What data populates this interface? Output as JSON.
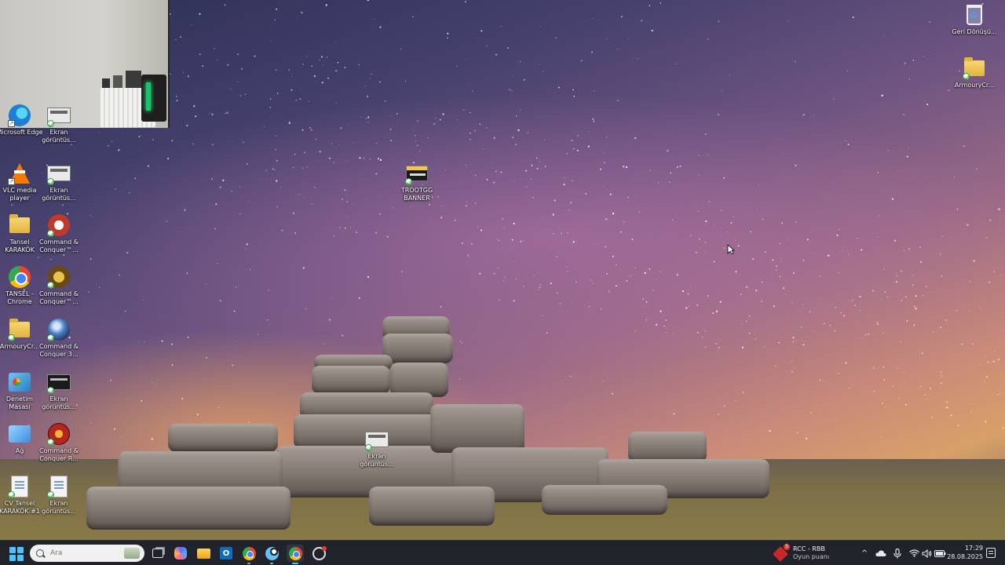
{
  "desktop": {
    "icons": [
      {
        "id": "edge",
        "label": "Microsoft Edge"
      },
      {
        "id": "shot1",
        "label": "Ekran görüntüs..."
      },
      {
        "id": "vlc",
        "label": "VLC media player"
      },
      {
        "id": "shot2",
        "label": "Ekran görüntüs..."
      },
      {
        "id": "tansel-folder",
        "label": "Tansel KARAKÖK"
      },
      {
        "id": "cnc3",
        "label": "Command & Conquer™..."
      },
      {
        "id": "chrome",
        "label": "TANSEL - Chrome"
      },
      {
        "id": "cnc-generals",
        "label": "Command & Conquer™..."
      },
      {
        "id": "armoury-folder-left",
        "label": "ArmouryCr..."
      },
      {
        "id": "cnc-sphere",
        "label": "Command & Conquer 3..."
      },
      {
        "id": "control-panel",
        "label": "Denetim Masası"
      },
      {
        "id": "shot3",
        "label": "Ekran görüntüs..."
      },
      {
        "id": "network",
        "label": "Ağ"
      },
      {
        "id": "cnc-red",
        "label": "Command & Conquer R..."
      },
      {
        "id": "cv",
        "label": "CV Tansel KARAKÖK #1"
      },
      {
        "id": "shot4",
        "label": "Ekran görüntüs..."
      },
      {
        "id": "trootgg",
        "label": "TROOTGG BANNER"
      },
      {
        "id": "shot5",
        "label": "Ekran görüntüs..."
      },
      {
        "id": "recycle-bin",
        "label": "Geri Dönüşü..."
      },
      {
        "id": "armoury-folder-right",
        "label": "ArmouryCr..."
      }
    ]
  },
  "taskbar": {
    "search_placeholder": "Ara",
    "outlook_letter": "O",
    "game_widget": {
      "badge": "5",
      "title": "RCC - RBB",
      "subtitle": "Oyun puanı"
    },
    "tray": {
      "chevron": "^",
      "time": "17:29",
      "date": "28.08.2025"
    }
  },
  "colors": {
    "taskbar_bg": "#20232a",
    "accent": "#4cc2ff"
  }
}
